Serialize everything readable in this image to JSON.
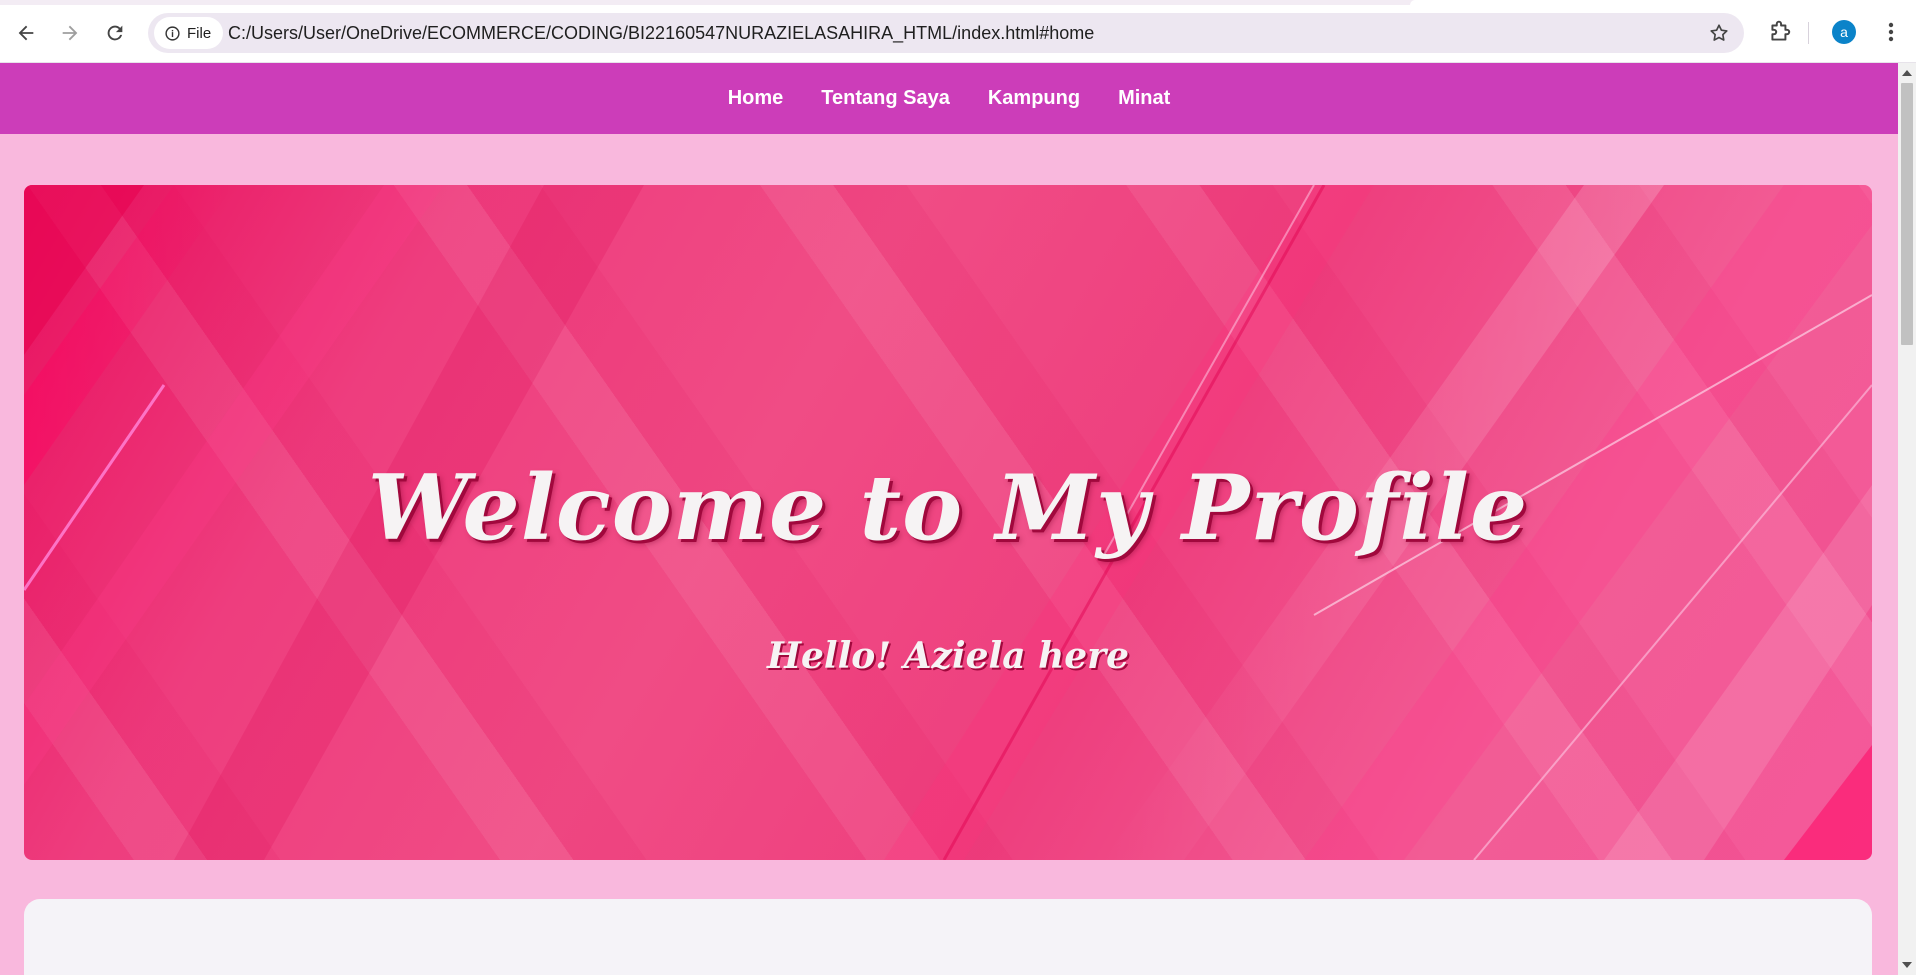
{
  "browser": {
    "site_chip_label": "File",
    "url": "C:/Users/User/OneDrive/ECOMMERCE/CODING/BI22160547NURAZIELASAHIRA_HTML/index.html#home",
    "avatar_letter": "a"
  },
  "nav": {
    "items": [
      {
        "label": "Home"
      },
      {
        "label": "Tentang Saya"
      },
      {
        "label": "Kampung"
      },
      {
        "label": "Minat"
      }
    ]
  },
  "hero": {
    "title": "Welcome to My Profile",
    "subtitle": "Hello! Aziela here"
  },
  "colors": {
    "nav_bg": "#cc3db9",
    "page_bg": "#f9b8dd",
    "hero_pink": "#ee3d7e",
    "card_bg": "#f5f3f8"
  }
}
